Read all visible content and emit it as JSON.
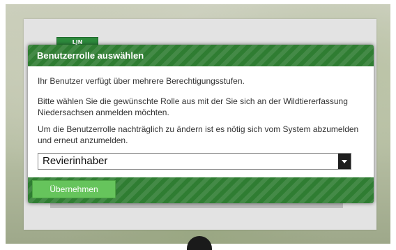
{
  "dialog": {
    "title": "Benutzerrolle auswählen",
    "paragraphs": [
      "Ihr Benutzer verfügt über mehrere Berechtigungsstufen.",
      "Bitte wählen Sie die gewünschte Rolle aus mit der Sie sich an der Wildtiererfassung Niedersachsen anmelden möchten.",
      "Um die Benutzerrolle nachträglich zu ändern ist es nötig sich vom System abzumelden und erneut anzumelden."
    ],
    "role_select": {
      "selected": "Revierinhaber",
      "icon": "chevron-down-icon"
    },
    "apply_label": "Übernehmen"
  },
  "background": {
    "logo_text": "LJN"
  },
  "colors": {
    "brand_green": "#2f7d32",
    "button_green": "#66c45c"
  }
}
